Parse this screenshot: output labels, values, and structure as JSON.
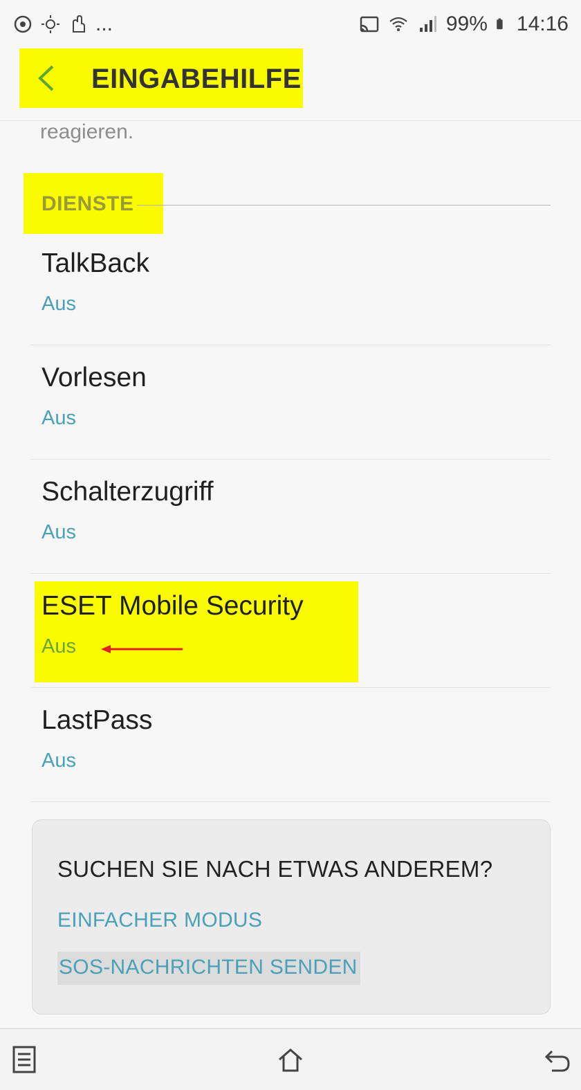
{
  "status_bar": {
    "left_icons": [
      "sync-icon",
      "brightness-icon",
      "touch-icon"
    ],
    "more_indicator": "...",
    "right_icons": [
      "cast-icon",
      "wifi-icon",
      "signal-icon"
    ],
    "battery": "99%",
    "time": "14:16"
  },
  "app_bar": {
    "title": "EINGABEHILFE",
    "back_icon": "chevron-left-icon"
  },
  "content": {
    "truncated_text": "reagieren.",
    "section_header": "DIENSTE",
    "items": [
      {
        "title": "TalkBack",
        "status": "Aus"
      },
      {
        "title": "Vorlesen",
        "status": "Aus"
      },
      {
        "title": "Schalterzugriff",
        "status": "Aus"
      },
      {
        "title": "ESET Mobile Security",
        "status": "Aus"
      },
      {
        "title": "LastPass",
        "status": "Aus"
      }
    ]
  },
  "card": {
    "title": "SUCHEN SIE NACH ETWAS ANDEREM?",
    "links": [
      "EINFACHER MODUS",
      "SOS-NACHRICHTEN SENDEN"
    ]
  },
  "nav_bar": {
    "icons": [
      "recent-apps-icon",
      "home-icon",
      "back-icon"
    ]
  },
  "colors": {
    "highlight": "#fbfb00",
    "accent_text": "#4aa0b8",
    "back_chevron": "#5aa83a",
    "annotation_arrow": "#e02020"
  }
}
